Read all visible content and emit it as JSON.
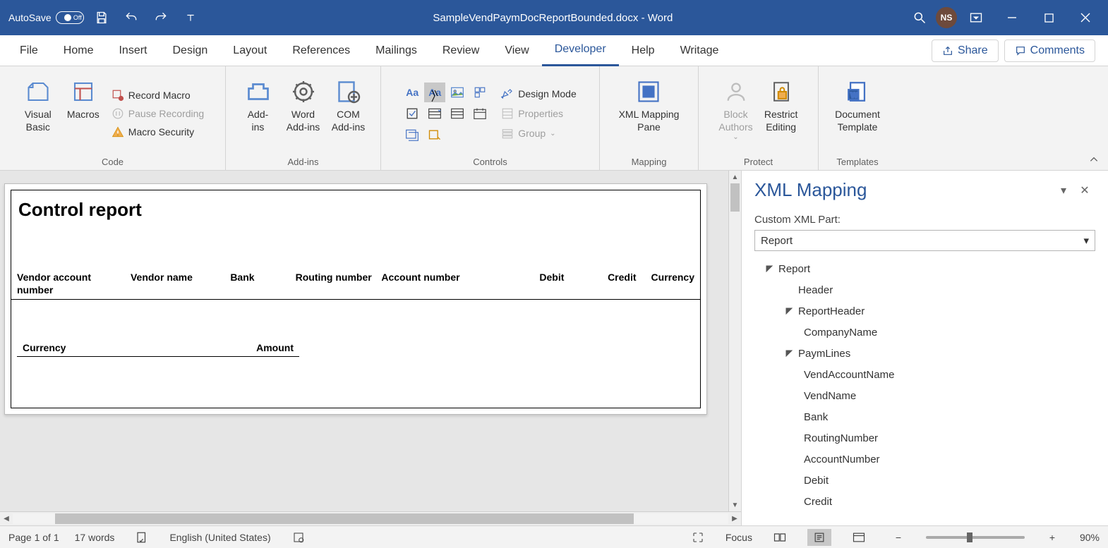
{
  "titlebar": {
    "autosave_label": "AutoSave",
    "autosave_state": "Off",
    "doc_title": "SampleVendPaymDocReportBounded.docx - Word",
    "user_initials": "NS"
  },
  "tabs": {
    "items": [
      "File",
      "Home",
      "Insert",
      "Design",
      "Layout",
      "References",
      "Mailings",
      "Review",
      "View",
      "Developer",
      "Help",
      "Writage"
    ],
    "active_index": 9,
    "share_label": "Share",
    "comments_label": "Comments"
  },
  "ribbon": {
    "code": {
      "group_label": "Code",
      "visual_basic": "Visual\nBasic",
      "macros": "Macros",
      "record_macro": "Record Macro",
      "pause_recording": "Pause Recording",
      "macro_security": "Macro Security"
    },
    "addins": {
      "group_label": "Add-ins",
      "addins": "Add-\nins",
      "word_addins": "Word\nAdd-ins",
      "com_addins": "COM\nAdd-ins"
    },
    "controls": {
      "group_label": "Controls",
      "aa1": "Aa",
      "aa2": "Aa",
      "design_mode": "Design Mode",
      "properties": "Properties",
      "group": "Group"
    },
    "mapping": {
      "group_label": "Mapping",
      "xml_mapping": "XML Mapping\nPane"
    },
    "protect": {
      "group_label": "Protect",
      "block_authors": "Block\nAuthors",
      "restrict_editing": "Restrict\nEditing"
    },
    "templates": {
      "group_label": "Templates",
      "doc_template": "Document\nTemplate"
    }
  },
  "document": {
    "title": "Control report",
    "headers": {
      "vendor_account": "Vendor account number",
      "vendor_name": "Vendor name",
      "bank": "Bank",
      "routing": "Routing number",
      "account": "Account number",
      "debit": "Debit",
      "credit": "Credit",
      "currency": "Currency",
      "currency2": "Currency",
      "amount": "Amount"
    }
  },
  "xmlpane": {
    "title": "XML Mapping",
    "subtitle": "Custom XML Part:",
    "selected": "Report",
    "tree": {
      "report": "Report",
      "header": "Header",
      "report_header": "ReportHeader",
      "company_name": "CompanyName",
      "paym_lines": "PaymLines",
      "vend_account_name": "VendAccountName",
      "vend_name": "VendName",
      "bank": "Bank",
      "routing_number": "RoutingNumber",
      "account_number": "AccountNumber",
      "debit": "Debit",
      "credit": "Credit"
    }
  },
  "status": {
    "page": "Page 1 of 1",
    "words": "17 words",
    "language": "English (United States)",
    "focus": "Focus",
    "zoom": "90%"
  }
}
